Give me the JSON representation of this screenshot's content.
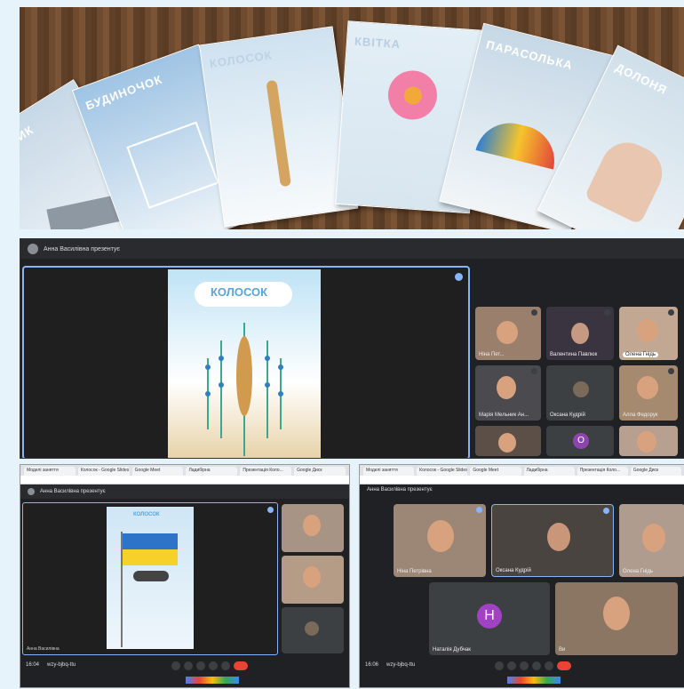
{
  "photo": {
    "cards": [
      {
        "title": "СОЮЗНИК"
      },
      {
        "title": "БУДИНОЧОК"
      },
      {
        "title": "КОЛОСОК"
      },
      {
        "title": "КВІТКА"
      },
      {
        "title": "ПАРАСОЛЬКА"
      },
      {
        "title": "ДОЛОНЯ"
      }
    ]
  },
  "main_meeting": {
    "presenter": "Анна Василівна презентує",
    "slide_title": "КОЛОСОК",
    "participants": [
      {
        "name": "Ніна Пет..."
      },
      {
        "name": "Валентина Павлюк"
      },
      {
        "name": "Олена Гнідь"
      },
      {
        "name": "Марія Мельник Ан..."
      },
      {
        "name": "Оксана Кудрій"
      },
      {
        "name": "Алла Федорук"
      },
      {
        "name": ""
      },
      {
        "name": "О"
      },
      {
        "name": ""
      }
    ]
  },
  "bottom_left": {
    "tabs": [
      "Моделі заняття",
      "Колосок - Google Slides",
      "Google Meet",
      "Ладибірна",
      "Презентація Коло...",
      "Google Диск"
    ],
    "presenter": "Анна Василівна презентує",
    "slide_title": "КОЛОСОК",
    "footer_time": "16:04",
    "footer_code": "wzy-bjbq-ttu",
    "self_name": "Анна Василівна"
  },
  "bottom_right": {
    "tabs": [
      "Моделі заняття",
      "Колосок - Google Slides",
      "Google Meet",
      "Ладибірна",
      "Презентація Коло...",
      "Google Диск"
    ],
    "presenter": "Анна Василівна презентує",
    "avatar_letter": "H",
    "tiles": [
      {
        "name": "Ніна Петрівна"
      },
      {
        "name": "Оксана Кудрій"
      },
      {
        "name": "Олена Гнідь"
      },
      {
        "name": "Наталія Дубчак"
      },
      {
        "name": "Ви"
      }
    ],
    "footer_time": "16:06",
    "footer_code": "wzy-bjbq-ttu"
  },
  "colors": {
    "meet_bg": "#202124",
    "end_call": "#ea4335",
    "accent": "#8ab4f8"
  }
}
